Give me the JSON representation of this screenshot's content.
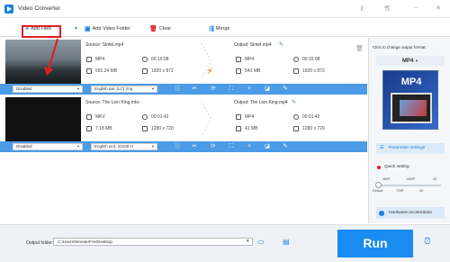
{
  "window": {
    "title": "Video Converter",
    "icons": [
      "app-logo-icon",
      "key-icon",
      "cart-icon",
      "minimize-icon",
      "close-icon"
    ]
  },
  "toolbar": {
    "add_files": "Add Files",
    "add_video_folder": "Add Video Folder",
    "clear": "Clear",
    "merge": "Merge"
  },
  "tasks": [
    {
      "source": "Source: Sintel.mp4",
      "output": "Output: Sintel.mp4",
      "src_format": "MP4",
      "src_duration": "00:15:08",
      "src_size": "691.24 MB",
      "src_resolution": "1920 x 872",
      "out_format": "MP4",
      "out_duration": "00:15:08",
      "out_size": "543 MB",
      "out_resolution": "1920 x 872",
      "subtitle": "Disabled",
      "audio": "English aac (LC) (mp"
    },
    {
      "source": "Source: The Lion King.mkv",
      "output": "Output: The Lion King.mp4",
      "src_format": "MKV",
      "src_duration": "00:01:42",
      "src_size": "7.18 MB",
      "src_resolution": "1280 x 720",
      "out_format": "MP4",
      "out_duration": "00:01:42",
      "out_size": "41 MB",
      "out_resolution": "1280 x 720",
      "subtitle": "Disabled",
      "audio": "English ac3, 44100 H"
    }
  ],
  "right_panel": {
    "caption": "Click to change output format:",
    "format": "MP4",
    "format_image_text": "MP4",
    "parameter_settings": "Parameter settings",
    "quick_setting": "Quick setting",
    "slider_top": [
      "480P",
      "1080P",
      "4K"
    ],
    "slider_bottom": [
      "Default",
      "720P",
      "2K"
    ],
    "hardware_acceleration": "Hardware acceleration",
    "quick_setting_value": 0
  },
  "bottom": {
    "output_folder_label": "Output folder:",
    "output_folder_value": "C:\\Users\\WonderFox\\Desktop",
    "run": "Run"
  },
  "colors": {
    "accent": "#1a8cf0",
    "control_bar": "#4b9be6",
    "bolt": "#f08a1c",
    "highlight": "#e02020"
  }
}
